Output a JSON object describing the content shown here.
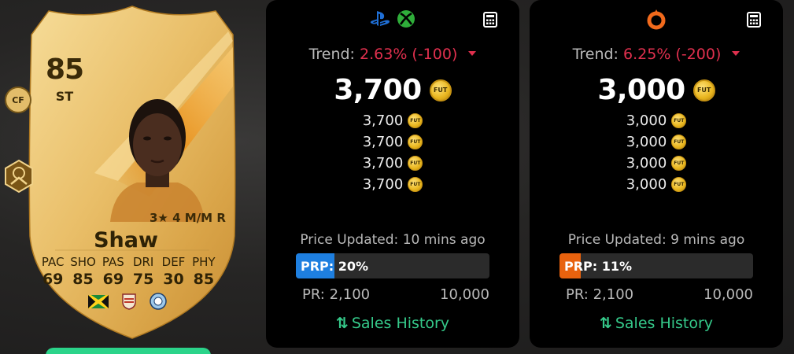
{
  "card": {
    "rating": "85",
    "position": "ST",
    "alt_position": "CF",
    "skills": "3★ 4 M/M R",
    "name": "Shaw",
    "stats": [
      {
        "label": "PAC",
        "value": "69"
      },
      {
        "label": "SHO",
        "value": "85"
      },
      {
        "label": "PAS",
        "value": "69"
      },
      {
        "label": "DRI",
        "value": "75"
      },
      {
        "label": "DEF",
        "value": "30"
      },
      {
        "label": "PHY",
        "value": "85"
      }
    ],
    "flags": [
      "jamaica-flag-icon",
      "league-badge-icon",
      "club-crest-icon"
    ],
    "colors": {
      "gold_light": "#f2d286",
      "gold_dark": "#c8922e",
      "text": "#2e2206"
    }
  },
  "panels": [
    {
      "id": "console",
      "platform_icons": [
        "playstation-icon",
        "xbox-icon"
      ],
      "trend_label": "Trend:",
      "trend_value": "2.63% (-100)",
      "price": "3,700",
      "recent_prices": [
        "3,700",
        "3,700",
        "3,700",
        "3,700"
      ],
      "updated": "Price Updated: 10 mins ago",
      "prp_label": "PRP: 20%",
      "prp_percent": 20,
      "prp_color": "#1e7fe0",
      "range_min": "PR: 2,100",
      "range_max": "10,000",
      "sales_label": "Sales History"
    },
    {
      "id": "pc",
      "platform_icons": [
        "origin-icon"
      ],
      "trend_label": "Trend:",
      "trend_value": "6.25% (-200)",
      "price": "3,000",
      "recent_prices": [
        "3,000",
        "3,000",
        "3,000",
        "3,000"
      ],
      "updated": "Price Updated: 9 mins ago",
      "prp_label": "PRP: 11%",
      "prp_percent": 11,
      "prp_color": "#e8620e",
      "range_min": "PR: 2,100",
      "range_max": "10,000",
      "sales_label": "Sales History"
    }
  ],
  "coin_label": "FUT",
  "colors": {
    "trend_down": "#e0304e",
    "sales": "#35c98a",
    "panel_bg": "#000000"
  }
}
